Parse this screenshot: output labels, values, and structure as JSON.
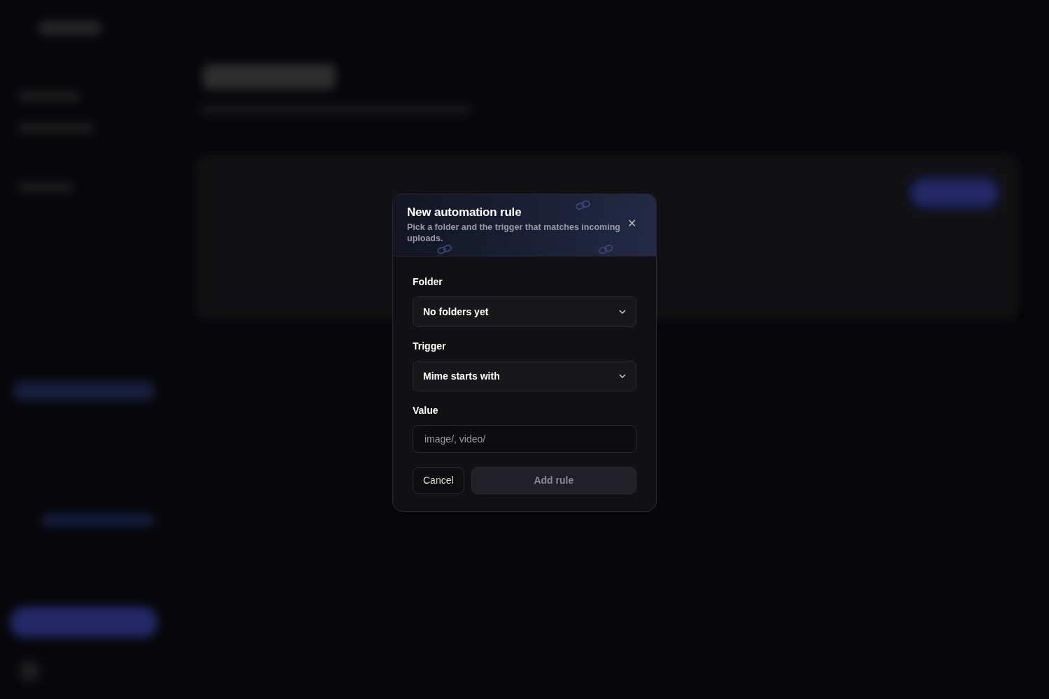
{
  "dialog": {
    "title": "New automation rule",
    "subtitle": "Pick a folder and the trigger that matches incoming uploads.",
    "close": "✕",
    "fields": [
      {
        "kind": "select",
        "label": "Folder",
        "value": "No folders yet"
      },
      {
        "kind": "select",
        "label": "Trigger",
        "value": "Mime starts with"
      },
      {
        "kind": "text",
        "label": "Value",
        "placeholder": "image/, video/"
      }
    ],
    "buttons": [
      {
        "label": "Cancel",
        "kind": "secondary",
        "disabled": false
      },
      {
        "label": "Add rule",
        "kind": "primary",
        "disabled": true
      }
    ]
  }
}
